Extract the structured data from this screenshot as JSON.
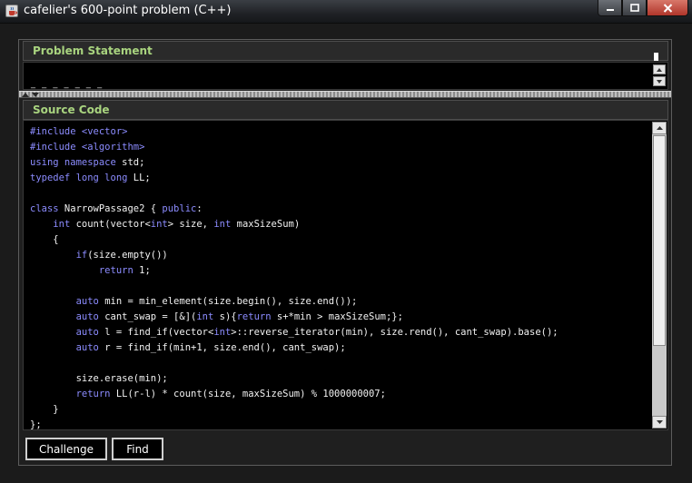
{
  "window": {
    "title": "cafelier's 600-point problem (C++)",
    "icon": "java-cup-icon",
    "controls": [
      "minimize-icon",
      "maximize-icon",
      "close-icon"
    ]
  },
  "colors": {
    "section_title": "#a9d47f",
    "keyword": "#8c8cff",
    "code_text": "#f2f2f2",
    "code_bg": "#000000"
  },
  "statement": {
    "header": "Problem Statement",
    "text": "_ _ _ _ _ _ _"
  },
  "source": {
    "header": "Source Code",
    "lines": [
      [
        [
          "pp",
          "#include <vector>"
        ]
      ],
      [
        [
          "pp",
          "#include <algorithm>"
        ]
      ],
      [
        [
          "kw",
          "using namespace"
        ],
        [
          "plain",
          " std;"
        ]
      ],
      [
        [
          "kw",
          "typedef long long"
        ],
        [
          "plain",
          " LL;"
        ]
      ],
      [
        [
          "plain",
          ""
        ]
      ],
      [
        [
          "kw",
          "class"
        ],
        [
          "plain",
          " NarrowPassage2 { "
        ],
        [
          "kw",
          "public"
        ],
        [
          "plain",
          ":"
        ]
      ],
      [
        [
          "plain",
          "    "
        ],
        [
          "kw",
          "int"
        ],
        [
          "plain",
          " count(vector<"
        ],
        [
          "kw",
          "int"
        ],
        [
          "plain",
          "> size, "
        ],
        [
          "kw",
          "int"
        ],
        [
          "plain",
          " maxSizeSum)"
        ]
      ],
      [
        [
          "plain",
          "    {"
        ]
      ],
      [
        [
          "plain",
          "        "
        ],
        [
          "kw",
          "if"
        ],
        [
          "plain",
          "(size.empty())"
        ]
      ],
      [
        [
          "plain",
          "            "
        ],
        [
          "kw",
          "return"
        ],
        [
          "plain",
          " 1;"
        ]
      ],
      [
        [
          "plain",
          ""
        ]
      ],
      [
        [
          "plain",
          "        "
        ],
        [
          "kw",
          "auto"
        ],
        [
          "plain",
          " min = min_element(size.begin(), size.end());"
        ]
      ],
      [
        [
          "plain",
          "        "
        ],
        [
          "kw",
          "auto"
        ],
        [
          "plain",
          " cant_swap = [&]("
        ],
        [
          "kw",
          "int"
        ],
        [
          "plain",
          " s){"
        ],
        [
          "kw",
          "return"
        ],
        [
          "plain",
          " s+*min > maxSizeSum;};"
        ]
      ],
      [
        [
          "plain",
          "        "
        ],
        [
          "kw",
          "auto"
        ],
        [
          "plain",
          " l = find_if(vector<"
        ],
        [
          "kw",
          "int"
        ],
        [
          "plain",
          ">::reverse_iterator(min), size.rend(), cant_swap).base();"
        ]
      ],
      [
        [
          "plain",
          "        "
        ],
        [
          "kw",
          "auto"
        ],
        [
          "plain",
          " r = find_if(min+1, size.end(), cant_swap);"
        ]
      ],
      [
        [
          "plain",
          ""
        ]
      ],
      [
        [
          "plain",
          "        size.erase(min);"
        ]
      ],
      [
        [
          "plain",
          "        "
        ],
        [
          "kw",
          "return"
        ],
        [
          "plain",
          " LL(r-l) * count(size, maxSizeSum) % 1000000007;"
        ]
      ],
      [
        [
          "plain",
          "    }"
        ]
      ],
      [
        [
          "plain",
          "};"
        ]
      ]
    ]
  },
  "buttons": {
    "challenge": "Challenge",
    "find": "Find"
  }
}
